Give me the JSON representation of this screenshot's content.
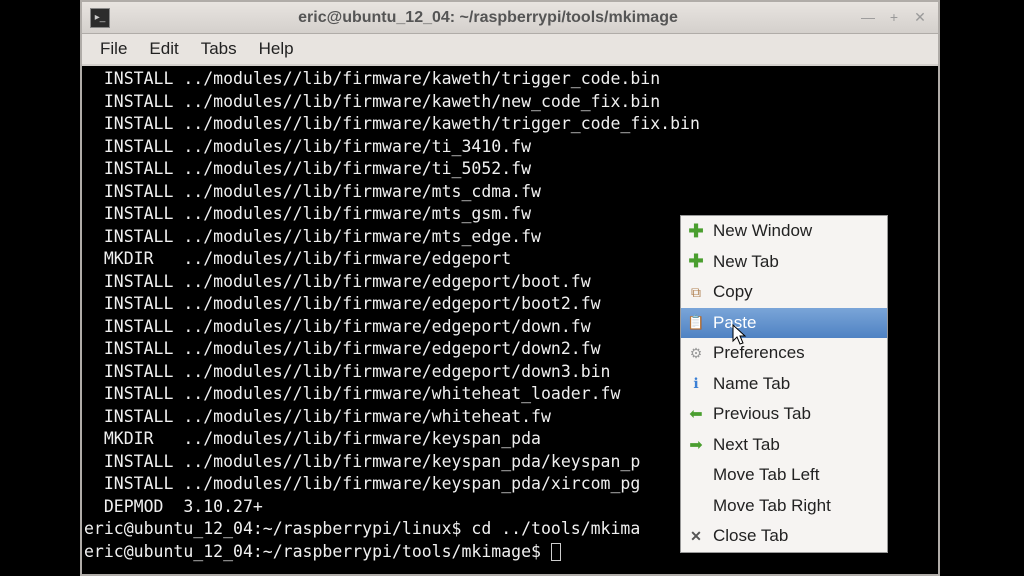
{
  "window": {
    "title": "eric@ubuntu_12_04: ~/raspberrypi/tools/mkimage"
  },
  "menubar": {
    "file": "File",
    "edit": "Edit",
    "tabs": "Tabs",
    "help": "Help"
  },
  "terminal": {
    "lines": [
      "  INSTALL ../modules//lib/firmware/kaweth/trigger_code.bin",
      "  INSTALL ../modules//lib/firmware/kaweth/new_code_fix.bin",
      "  INSTALL ../modules//lib/firmware/kaweth/trigger_code_fix.bin",
      "  INSTALL ../modules//lib/firmware/ti_3410.fw",
      "  INSTALL ../modules//lib/firmware/ti_5052.fw",
      "  INSTALL ../modules//lib/firmware/mts_cdma.fw",
      "  INSTALL ../modules//lib/firmware/mts_gsm.fw",
      "  INSTALL ../modules//lib/firmware/mts_edge.fw",
      "  MKDIR   ../modules//lib/firmware/edgeport",
      "  INSTALL ../modules//lib/firmware/edgeport/boot.fw",
      "  INSTALL ../modules//lib/firmware/edgeport/boot2.fw",
      "  INSTALL ../modules//lib/firmware/edgeport/down.fw",
      "  INSTALL ../modules//lib/firmware/edgeport/down2.fw",
      "  INSTALL ../modules//lib/firmware/edgeport/down3.bin",
      "  INSTALL ../modules//lib/firmware/whiteheat_loader.fw",
      "  INSTALL ../modules//lib/firmware/whiteheat.fw",
      "  MKDIR   ../modules//lib/firmware/keyspan_pda",
      "  INSTALL ../modules//lib/firmware/keyspan_pda/keyspan_p",
      "  INSTALL ../modules//lib/firmware/keyspan_pda/xircom_pg",
      "  DEPMOD  3.10.27+"
    ],
    "prompt1": "eric@ubuntu_12_04:~/raspberrypi/linux$ cd ../tools/mkima",
    "prompt2": "eric@ubuntu_12_04:~/raspberrypi/tools/mkimage$ "
  },
  "context_menu": {
    "items": [
      {
        "icon": "plus",
        "label": "New Window"
      },
      {
        "icon": "plus",
        "label": "New Tab"
      },
      {
        "icon": "copy",
        "label": "Copy"
      },
      {
        "icon": "paste",
        "label": "Paste",
        "highlighted": true
      },
      {
        "icon": "gear",
        "label": "Preferences"
      },
      {
        "icon": "info",
        "label": "Name Tab"
      },
      {
        "icon": "left",
        "label": "Previous Tab"
      },
      {
        "icon": "right",
        "label": "Next Tab"
      },
      {
        "icon": "",
        "label": "Move Tab Left"
      },
      {
        "icon": "",
        "label": "Move Tab Right"
      },
      {
        "icon": "close",
        "label": "Close Tab"
      }
    ]
  }
}
